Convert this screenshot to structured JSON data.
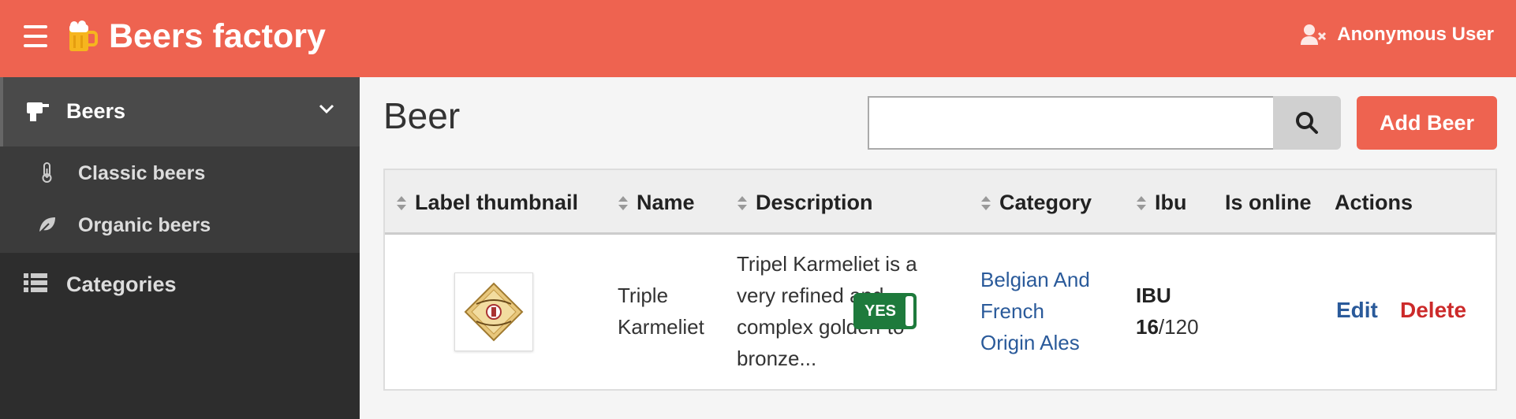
{
  "header": {
    "app_title": "Beers factory",
    "user_label": "Anonymous User"
  },
  "sidebar": {
    "parent_label": "Beers",
    "sub_items": [
      "Classic beers",
      "Organic beers"
    ],
    "categories_label": "Categories"
  },
  "main": {
    "page_title": "Beer",
    "search_placeholder": "",
    "add_button_label": "Add Beer"
  },
  "table": {
    "columns": [
      "Label thumbnail",
      "Name",
      "Description",
      "Category",
      "Ibu",
      "Is online",
      "Actions"
    ],
    "row": {
      "name_line1": "Triple",
      "name_line2": "Karmeliet",
      "desc_lines": [
        "Tripel Karmeliet is a",
        "very refined and",
        "complex golden-to-",
        "bronze..."
      ],
      "category_lines": [
        "Belgian And",
        "French",
        "Origin Ales"
      ],
      "ibu_label": "IBU",
      "ibu_value": "16",
      "ibu_max": "/120",
      "online_label": "YES",
      "edit_label": "Edit",
      "delete_label": "Delete"
    }
  },
  "colors": {
    "accent": "#ee6350",
    "sidebar_bg": "#2d2d2d",
    "link": "#2a5a9a",
    "delete": "#cc2a2a",
    "online": "#1e7a3c"
  }
}
